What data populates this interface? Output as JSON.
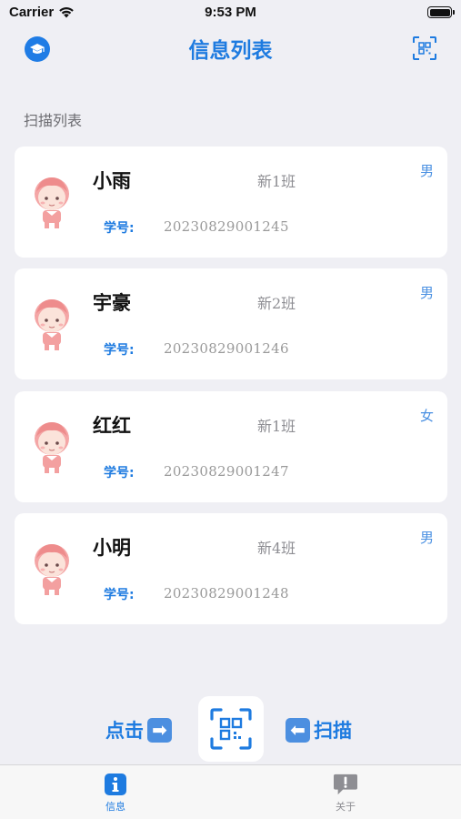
{
  "status_bar": {
    "carrier": "Carrier",
    "time": "9:53 PM"
  },
  "nav": {
    "title": "信息列表",
    "left_icon": "graduation-cap-icon",
    "right_icon": "qr-scan-icon"
  },
  "section": {
    "header": "扫描列表"
  },
  "students": [
    {
      "name": "小雨",
      "class": "新1班",
      "gender": "男",
      "id_label": "学号:",
      "id": "20230829001245"
    },
    {
      "name": "宇豪",
      "class": "新2班",
      "gender": "男",
      "id_label": "学号:",
      "id": "20230829001246"
    },
    {
      "name": "红红",
      "class": "新1班",
      "gender": "女",
      "id_label": "学号:",
      "id": "20230829001247"
    },
    {
      "name": "小明",
      "class": "新4班",
      "gender": "男",
      "id_label": "学号:",
      "id": "20230829001248"
    }
  ],
  "scan_bar": {
    "left_text": "点击",
    "left_arrow": "➡",
    "right_arrow": "⬅",
    "right_text": "扫描"
  },
  "tabs": [
    {
      "label": "信息",
      "icon": "info-icon",
      "active": true
    },
    {
      "label": "关于",
      "icon": "speech-bubble-exclamation-icon",
      "active": false
    }
  ],
  "colors": {
    "accent": "#1e7be0",
    "background": "#efeff4",
    "card": "#ffffff",
    "avatar_skin": "#f4a6a6"
  }
}
